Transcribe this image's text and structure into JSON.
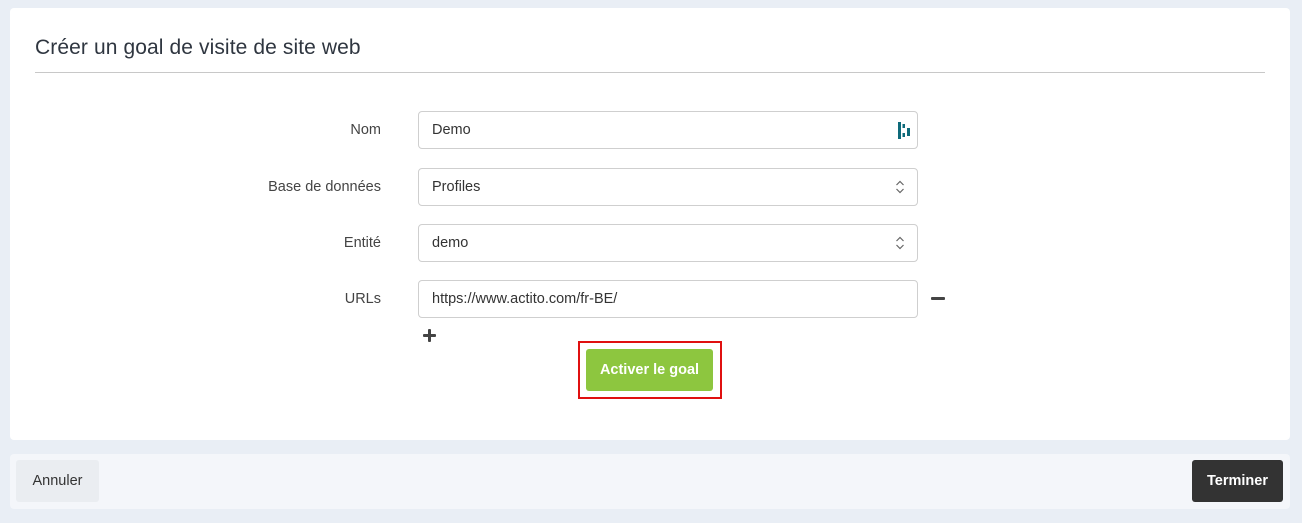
{
  "dialog": {
    "title": "Créer un goal de visite de site web"
  },
  "form": {
    "name": {
      "label": "Nom",
      "value": "Demo",
      "icon": "password-manager-icon"
    },
    "database": {
      "label": "Base de données",
      "selected": "Profiles"
    },
    "entity": {
      "label": "Entité",
      "selected": "demo"
    },
    "urls": {
      "label": "URLs",
      "items": [
        "https://www.actito.com/fr-BE/"
      ],
      "remove_icon": "minus-icon",
      "add_icon": "plus-icon"
    },
    "activate_label": "Activer le goal"
  },
  "footer": {
    "cancel_label": "Annuler",
    "finish_label": "Terminer"
  },
  "colors": {
    "accent_green": "#8dc63f",
    "highlight_red": "#e01010",
    "finish_dark": "#333333",
    "dashlane_teal": "#0e6a7a"
  }
}
